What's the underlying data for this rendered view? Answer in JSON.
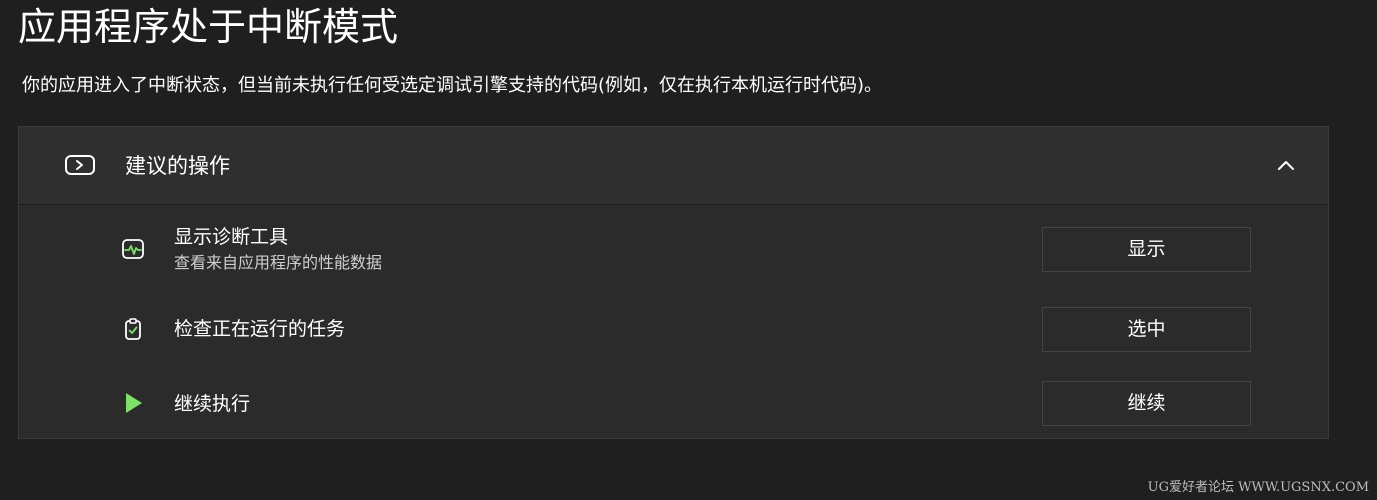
{
  "page": {
    "title": "应用程序处于中断模式",
    "description": "你的应用进入了中断状态，但当前未执行任何受选定调试引擎支持的代码(例如，仅在执行本机运行时代码)。"
  },
  "suggested_actions": {
    "header_label": "建议的操作",
    "header_icon": "console-icon",
    "collapse_icon": "chevron-up-icon",
    "items": [
      {
        "icon": "diagnostics-pulse-icon",
        "title": "显示诊断工具",
        "description": "查看来自应用程序的性能数据",
        "button_label": "显示"
      },
      {
        "icon": "clipboard-check-icon",
        "title": "检查正在运行的任务",
        "button_label": "选中"
      },
      {
        "icon": "play-icon",
        "title": "继续执行",
        "button_label": "继续"
      }
    ]
  },
  "colors": {
    "background": "#1f1f1f",
    "panel": "#2b2b2b",
    "accent_green": "#7ee06a"
  },
  "watermark": "UG爱好者论坛 WWW.UGSNX.COM"
}
